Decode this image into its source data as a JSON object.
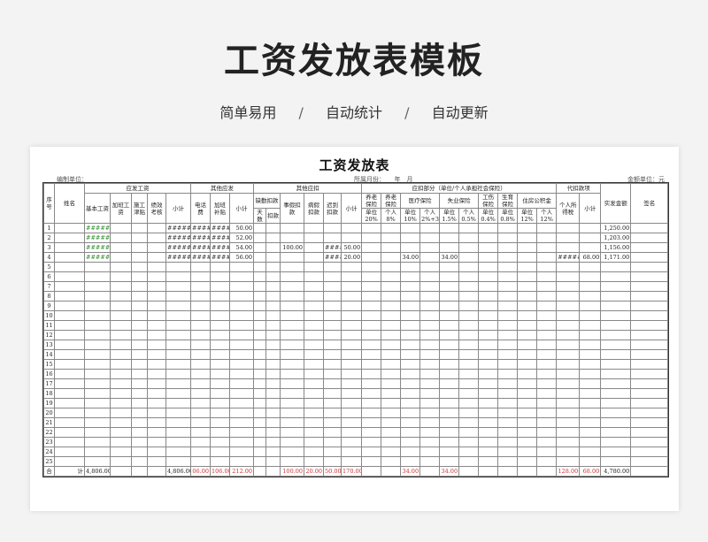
{
  "hero": {
    "title": "工资发放表模板",
    "tags": [
      "简单易用",
      "自动统计",
      "自动更新"
    ],
    "separator": "/"
  },
  "sheet": {
    "title": "工资发放表",
    "unit_label": "编制单位：",
    "month_label": "所属月份：　　年　月",
    "currency_label": "金额单位：元"
  },
  "headers": {
    "seq": "序号",
    "name": "姓名",
    "payable": "应发工资",
    "payable_cols": [
      "基本工资",
      "加班工资",
      "施工津贴",
      "绩效考核",
      "小计"
    ],
    "other_payable": "其他应发",
    "other_payable_cols": [
      "电话费",
      "加班补贴",
      "小计"
    ],
    "other_deduct": "其他应扣",
    "absence": "缺勤扣款",
    "absence_cols": [
      "天数",
      "扣款"
    ],
    "other_deduct_cols": [
      "事假扣款",
      "病假扣款",
      "迟到扣款",
      "小计"
    ],
    "insurance": "应扣部分（单位/个人承担社会保险）",
    "pension": "养老保险",
    "pension2": "养老保险",
    "medical": "医疗保险",
    "unemployment": "失业保险",
    "injury": "工伤保险",
    "maternity": "生育保险",
    "housing": "住房公积金",
    "withhold": "代扣款项",
    "income_tax": "个人所得税",
    "withhold_subtotal": "小计",
    "net": "实发金额",
    "sign": "签名",
    "rate_row": [
      "单位20%",
      "个人8%",
      "单位10%",
      "个人2%+3",
      "单位1.5%",
      "个人0.5%",
      "单位0.4%",
      "单位0.8%",
      "单位12%",
      "个人12%"
    ]
  },
  "rows": [
    {
      "no": "1",
      "basic": "#######",
      "sub1": "#######",
      "phone": "#####",
      "ot": "#####",
      "sub2": "50.00",
      "late": "",
      "sub3": "",
      "p_ind": "",
      "m_ind": "",
      "tax": "",
      "wsub": "",
      "net": "1,250.00",
      "leave": ""
    },
    {
      "no": "2",
      "basic": "#######",
      "sub1": "#######",
      "phone": "#####",
      "ot": "#####",
      "sub2": "52.00",
      "late": "",
      "sub3": "",
      "p_ind": "",
      "m_ind": "",
      "tax": "",
      "wsub": "",
      "net": "1,203.00",
      "leave": ""
    },
    {
      "no": "3",
      "basic": "#######",
      "sub1": "#######",
      "phone": "#####",
      "ot": "#####",
      "sub2": "54.00",
      "late": "#####",
      "sub3": "50.00",
      "p_ind": "",
      "m_ind": "",
      "tax": "",
      "wsub": "",
      "net": "1,156.00",
      "leave": "100.00"
    },
    {
      "no": "4",
      "basic": "#######",
      "sub1": "#######",
      "phone": "#####",
      "ot": "#####",
      "sub2": "56.00",
      "late": "#####",
      "sub3": "20.00",
      "p_ind": "34.00",
      "m_ind": "34.00",
      "tax": "######",
      "wsub": "68.00",
      "net": "1,171.00",
      "leave": ""
    }
  ],
  "row3_sub3_extra": "#####",
  "empty_rows": [
    "5",
    "6",
    "7",
    "8",
    "9",
    "10",
    "11",
    "12",
    "13",
    "14",
    "15",
    "16",
    "17",
    "18",
    "19",
    "20",
    "21",
    "22",
    "23",
    "24",
    "25"
  ],
  "totals": {
    "label1": "合",
    "label2": "计",
    "basic": "4,806.00",
    "sub1": "4,806.00",
    "phone": "06.00",
    "ot": "106.00",
    "sub2": "212.00",
    "leave": "100.00",
    "sick": "20.00",
    "late": "50.00",
    "sub3": "170.00",
    "p_ind": "34.00",
    "m_ind": "34.00",
    "tax": "128.00",
    "wsub": "68.00",
    "net": "4,780.00"
  },
  "colors": {
    "hash_green": "#2a8a2a",
    "total_red": "#c33333"
  }
}
